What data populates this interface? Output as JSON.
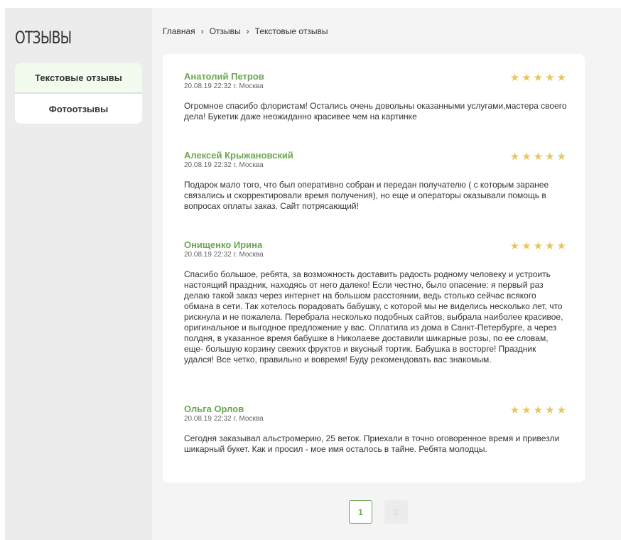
{
  "sidebar": {
    "title": "ОТЗЫВЫ",
    "items": [
      {
        "label": "Текстовые отзывы"
      },
      {
        "label": "Фотоотзывы"
      }
    ]
  },
  "breadcrumb": [
    "Главная",
    "Отзывы",
    "Текстовые отзывы"
  ],
  "reviews": [
    {
      "name": "Анатолий Петров",
      "meta": "20.08.19 22:32 г. Москва",
      "stars": "★★★★★",
      "text": "Огромное спасибо флористам! Остались очень довольны оказанными услугами,мастера своего дела! Букетик даже неожиданно красивее чем на картинке"
    },
    {
      "name": "Алексей Крыжановский",
      "meta": "20.08.19 22:32 г. Москва",
      "stars": "★★★★★",
      "text": "Подарок мало того, что был оперативно собран и передан получателю ( с которым заранее связались и скорректировали время получения), но еще и операторы оказывали помощь в вопросах оплаты заказ. Сайт потрясающий!"
    },
    {
      "name": "Онищенко Ирина",
      "meta": "20.08.19 22:32 г. Москва",
      "stars": "★★★★★",
      "text": "Спасибо большое, ребята, за возможность доставить радость родному человеку и устроить настоящий праздник, находясь от него далеко! Если честно, было опасение: я первый раз делаю такой заказ через интернет на большом расстоянии, ведь столько сейчас всякого обмана в сети. Так хотелось порадовать бабушку, с которой мы не виделись несколько лет, что рискнула и не пожалела. Перебрала несколько подобных сайтов, выбрала наиболее красивое, оригинальное и выгодное предложение у вас. Оплатила из дома в Санкт-Петербурге, а через полдня, в указанное время бабушке в Николаеве доставили шикарные розы, по ее словам, еще- большую корзину свежих фруктов и вкусный тортик. Бабушка в восторге! Праздник удался! Все четко, правильно и вовремя! Буду рекомендовать вас знакомым."
    },
    {
      "name": "Ольга Орлов",
      "meta": "20.08.19 22:32 г. Москва",
      "stars": "★★★★★",
      "text": "Сегодня заказывал альстромерию, 25 веток. Приехали в точно оговоренное время и привезли шикарный букет. Как и просил - мое имя осталось в тайне. Ребята молодцы."
    }
  ],
  "pagination": {
    "current": "1",
    "next": "2"
  }
}
